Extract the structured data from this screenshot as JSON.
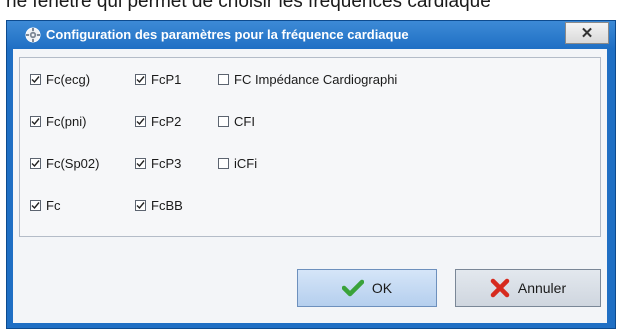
{
  "caption": "ne fenêtre qui permet de choisir les fréquences cardiaque",
  "dialog": {
    "title": "Configuration des paramètres pour la fréquence cardiaque",
    "close_label": "✕"
  },
  "checkboxes": {
    "col1": [
      {
        "label": "Fc(ecg)",
        "checked": true
      },
      {
        "label": "Fc(pni)",
        "checked": true
      },
      {
        "label": "Fc(Sp02)",
        "checked": true
      },
      {
        "label": "Fc",
        "checked": true
      }
    ],
    "col2": [
      {
        "label": "FcP1",
        "checked": true
      },
      {
        "label": "FcP2",
        "checked": true
      },
      {
        "label": "FcP3",
        "checked": true
      },
      {
        "label": "FcBB",
        "checked": true
      }
    ],
    "col3": [
      {
        "label": "FC Impédance Cardiographi",
        "checked": false
      },
      {
        "label": "CFI",
        "checked": false
      },
      {
        "label": "iCFi",
        "checked": false
      }
    ]
  },
  "buttons": {
    "ok_label": "OK",
    "cancel_label": "Annuler"
  },
  "colors": {
    "titlebar": "#1f6fc4",
    "ok_icon": "#3aa23a",
    "cancel_icon": "#d62a1e"
  }
}
